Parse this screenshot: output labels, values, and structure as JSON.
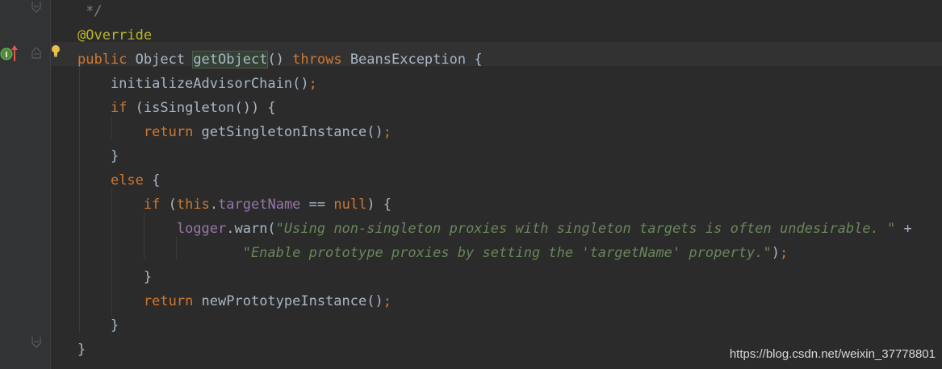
{
  "editor": {
    "lines": [
      {
        "id": "l0",
        "parts": [
          {
            "t": " */",
            "c": "cmt"
          }
        ]
      },
      {
        "id": "l1",
        "parts": [
          {
            "t": "@Override",
            "c": "ann"
          }
        ]
      },
      {
        "id": "l2",
        "parts": [
          {
            "t": "public ",
            "c": "kw"
          },
          {
            "t": "Object "
          },
          {
            "t": "getObject",
            "c": "hl"
          },
          {
            "t": "() "
          },
          {
            "t": "throws ",
            "c": "kw"
          },
          {
            "t": "BeansException {"
          }
        ]
      },
      {
        "id": "l3",
        "parts": [
          {
            "t": "    initializeAdvisorChain()"
          },
          {
            "t": ";",
            "c": "semi"
          }
        ]
      },
      {
        "id": "l4",
        "parts": [
          {
            "t": "    "
          },
          {
            "t": "if ",
            "c": "kw"
          },
          {
            "t": "(isSingleton()) {"
          }
        ]
      },
      {
        "id": "l5",
        "parts": [
          {
            "t": "        "
          },
          {
            "t": "return ",
            "c": "kw"
          },
          {
            "t": "getSingletonInstance()"
          },
          {
            "t": ";",
            "c": "semi"
          }
        ]
      },
      {
        "id": "l6",
        "parts": [
          {
            "t": "    }"
          }
        ]
      },
      {
        "id": "l7",
        "parts": [
          {
            "t": "    "
          },
          {
            "t": "else ",
            "c": "kw"
          },
          {
            "t": "{"
          }
        ]
      },
      {
        "id": "l8",
        "parts": [
          {
            "t": "        "
          },
          {
            "t": "if ",
            "c": "kw"
          },
          {
            "t": "("
          },
          {
            "t": "this",
            "c": "kw"
          },
          {
            "t": "."
          },
          {
            "t": "targetName",
            "c": "fld"
          },
          {
            "t": " == "
          },
          {
            "t": "null",
            "c": "kw"
          },
          {
            "t": ") {"
          }
        ]
      },
      {
        "id": "l9",
        "parts": [
          {
            "t": "            "
          },
          {
            "t": "logger",
            "c": "fld"
          },
          {
            "t": ".warn("
          },
          {
            "t": "\"Using non-singleton proxies with singleton targets is often undesirable. \"",
            "c": "str"
          },
          {
            "t": " +"
          }
        ]
      },
      {
        "id": "l10",
        "parts": [
          {
            "t": "                    "
          },
          {
            "t": "\"Enable prototype proxies by setting the 'targetName' property.\"",
            "c": "str"
          },
          {
            "t": ")"
          },
          {
            "t": ";",
            "c": "semi"
          }
        ]
      },
      {
        "id": "l11",
        "parts": [
          {
            "t": "        }"
          }
        ]
      },
      {
        "id": "l12",
        "parts": [
          {
            "t": "        "
          },
          {
            "t": "return ",
            "c": "kw"
          },
          {
            "t": "newPrototypeInstance()"
          },
          {
            "t": ";",
            "c": "semi"
          }
        ]
      },
      {
        "id": "l13",
        "parts": [
          {
            "t": "    }"
          }
        ]
      },
      {
        "id": "l14",
        "parts": [
          {
            "t": "}"
          }
        ]
      }
    ],
    "current_line": 2,
    "caret_before": "getObject"
  },
  "gutter_icons": [
    "implements-method-icon",
    "override-up-arrow-icon",
    "intention-bulb-icon",
    "fold-icon"
  ],
  "watermark": "https://blog.csdn.net/weixin_37778801",
  "colors": {
    "background": "#2b2b2b",
    "gutter": "#313335",
    "keyword": "#cc7832",
    "annotation": "#bbb529",
    "string": "#6a8759",
    "field": "#9876aa",
    "text": "#a9b7c6",
    "comment": "#808080"
  }
}
